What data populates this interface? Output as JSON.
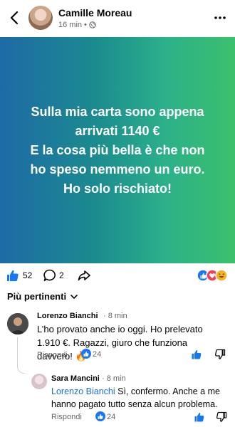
{
  "header": {
    "author": "Camille Moreau",
    "time": "16 min",
    "separator": "•"
  },
  "post": {
    "text": "Sulla mia carta sono appena\narrivati 1140 €\nE la cosa più bella è che non\nho speso nemmeno un euro.\nHo solo rischiato!",
    "background_colors": [
      "#1e6aa6",
      "#2bb08a",
      "#3cc06d"
    ]
  },
  "reactions": {
    "like_count": "52",
    "comment_count": "2"
  },
  "sort": {
    "label": "Più pertinenti"
  },
  "comments": [
    {
      "author": "Lorenzo Bianchi",
      "time": "· 8 min",
      "text": "L’ho provato anche io oggi. Ho prelevato 1.910 €. Ragazzi, giuro che funziona davvero! 🔥",
      "reply_label": "Rispondi",
      "likes": "24"
    },
    {
      "author": "Sara Mancini",
      "time": "· 8 min",
      "mention": "Lorenzo Bianchi",
      "text": " Sì, confermo. Anche a me hanno pagato tutto senza alcun problema.",
      "reply_label": "Rispondi",
      "likes": "24"
    }
  ],
  "colors": {
    "like_blue": "#1877f2",
    "mention": "#216fdb",
    "muted": "#65676b"
  }
}
